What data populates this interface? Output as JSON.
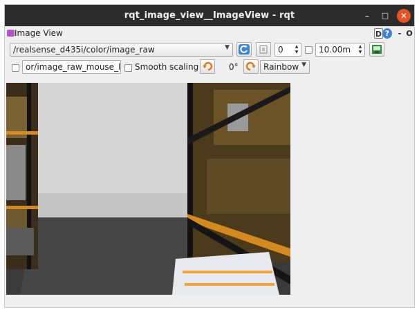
{
  "window": {
    "title": "rqt_image_view__ImageView - rqt",
    "controls": [
      "minimize",
      "maximize",
      "close"
    ]
  },
  "plugin": {
    "title": "Image View",
    "d_label": "D",
    "help_label": "?",
    "dash_label": "-",
    "o_label": "O"
  },
  "toolbar": {
    "topic": "/realsense_d435i/color/image_raw",
    "refresh_icon": "refresh-icon",
    "zoom_icon": "zoom-icon",
    "fps_value": "0",
    "rate_enabled": false,
    "rate_value": "10.00m",
    "save_icon": "save-icon"
  },
  "toolbar2": {
    "mouse_enabled": false,
    "mouse_topic": "or/image_raw_mouse_left",
    "smooth_label": "Smooth scaling",
    "smooth_enabled": false,
    "rotate_left_icon": "rotate-left-icon",
    "rotation": "0°",
    "rotate_right_icon": "rotate-right-icon",
    "colormap": "Rainbow"
  },
  "image": {
    "description_icon": "camera-image"
  }
}
